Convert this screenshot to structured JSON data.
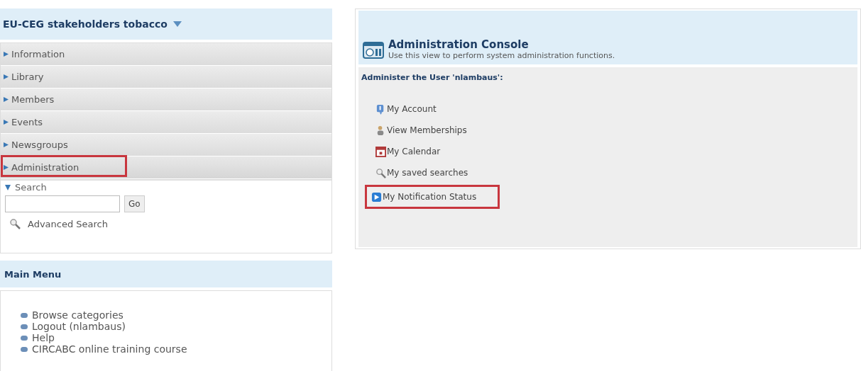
{
  "sidebar": {
    "title": "EU-CEG stakeholders tobacco",
    "nav_items": [
      {
        "label": "Information",
        "highlighted": false
      },
      {
        "label": "Library",
        "highlighted": false
      },
      {
        "label": "Members",
        "highlighted": false
      },
      {
        "label": "Events",
        "highlighted": false
      },
      {
        "label": "Newsgroups",
        "highlighted": false
      },
      {
        "label": "Administration",
        "highlighted": true
      }
    ],
    "search": {
      "label": "Search",
      "button": "Go",
      "advanced": "Advanced Search"
    },
    "main_menu": {
      "title": "Main Menu",
      "items": [
        "Browse categories",
        "Logout (nlambaus)",
        "Help",
        "CIRCABC online training course"
      ]
    }
  },
  "console": {
    "title": "Administration Console",
    "subtitle": "Use this view to perform system administration functions.",
    "heading": "Administer the User 'nlambaus':",
    "links": [
      {
        "kind": "account",
        "label": "My Account",
        "highlighted": false
      },
      {
        "kind": "memberships",
        "label": "View Memberships",
        "highlighted": false
      },
      {
        "kind": "calendar",
        "label": "My Calendar",
        "highlighted": false
      },
      {
        "kind": "search",
        "label": "My saved searches",
        "highlighted": false
      },
      {
        "kind": "notification",
        "label": "My Notification Status",
        "highlighted": true
      }
    ]
  }
}
